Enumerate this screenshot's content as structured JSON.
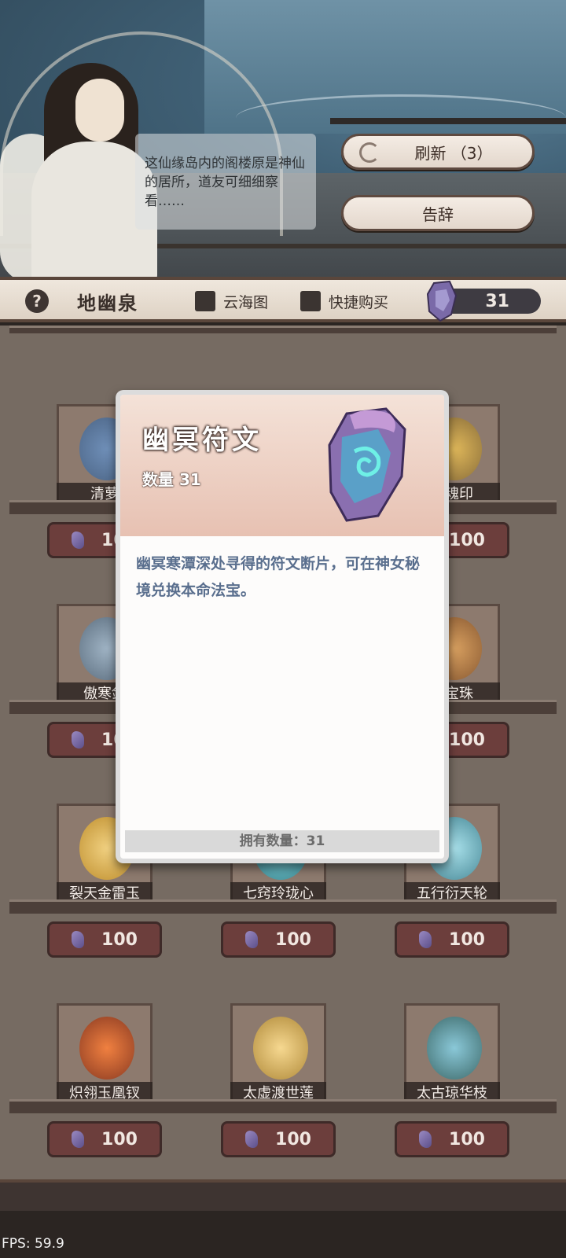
{
  "npc": {
    "dialog": "这仙缘岛内的阁楼原是神仙的居所，道友可细细察看……"
  },
  "buttons": {
    "refresh_label": "刷新 （3）",
    "leave_label": "告辞"
  },
  "toolbar": {
    "help": "?",
    "shop_name": "地幽泉",
    "option1": "云海图",
    "option2": "快捷购买",
    "currency_amount": "31"
  },
  "items": [
    {
      "name": "清萝",
      "price": "100"
    },
    {
      "name": "铸魂印",
      "price": "100"
    },
    {
      "name": "傲寒剑",
      "price": "100"
    },
    {
      "name": "玲宝珠",
      "price": "100"
    },
    {
      "name": "裂天金雷玉",
      "price": "100"
    },
    {
      "name": "七窍玲珑心",
      "price": "100"
    },
    {
      "name": "五行衍天轮",
      "price": "100"
    },
    {
      "name": "炽翎玉凰钗",
      "price": "100"
    },
    {
      "name": "太虚渡世莲",
      "price": "100"
    },
    {
      "name": "太古琼华枝",
      "price": "100"
    }
  ],
  "modal": {
    "title": "幽冥符文",
    "quantity": "数量 31",
    "description": "幽冥寒潭深处寻得的符文断片，可在神女秘境兑换本命法宝。",
    "owned": "拥有数量：31"
  },
  "fps": "FPS: 59.9",
  "colors": {
    "modal_header": "#e7c1b2",
    "description_text": "#5a6f8e",
    "price_tag": "#6c3e3c"
  }
}
